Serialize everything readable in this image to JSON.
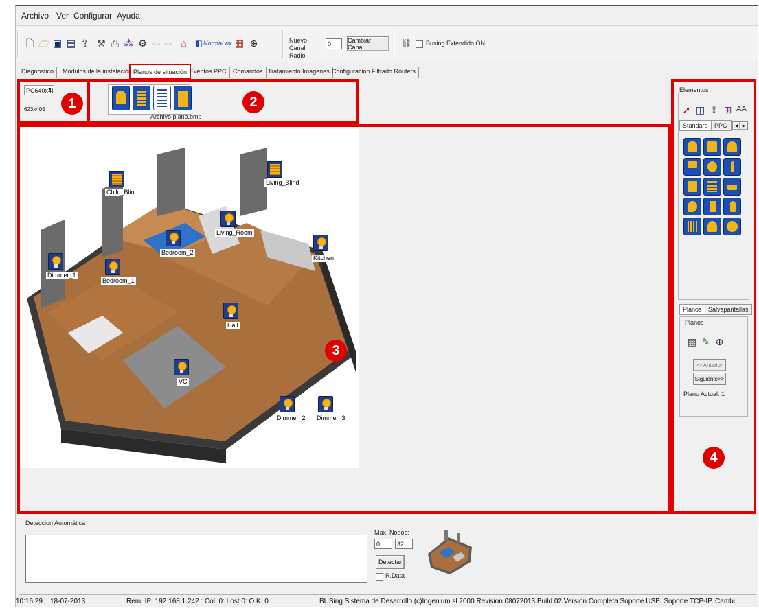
{
  "menu": [
    "Archivo",
    "Ver",
    "Configurar",
    "Ayuda"
  ],
  "toolbar": {
    "normalux_label": "NormaLux",
    "nuevo_canal_label": "Nuevo Canal Radio",
    "canal_value": "0",
    "cambiar_canal_label": "Cambiar Canal",
    "busing_extendido_label": "Busing Extendido ON"
  },
  "tabs": [
    {
      "label": "Diagnostico",
      "active": false
    },
    {
      "label": "Modulos de la instalación",
      "active": false
    },
    {
      "label": "Planos de situación",
      "active": true
    },
    {
      "label": "Eventos PPC",
      "active": false
    },
    {
      "label": "Comandos",
      "active": false
    },
    {
      "label": "Tratamiento Imagenes",
      "active": false
    },
    {
      "label": "Configuracion Filtrado Routers",
      "active": false
    }
  ],
  "resolution": {
    "selected": "PC640x4I",
    "size": "623x405"
  },
  "file": {
    "name": "Archivo plano.bmp"
  },
  "badges": [
    "1",
    "2",
    "3",
    "4"
  ],
  "plan": {
    "devices": [
      {
        "label": "Child_Blind",
        "type": "blind"
      },
      {
        "label": "Living_Blind",
        "type": "blind"
      },
      {
        "label": "Living_Room",
        "type": "bulb"
      },
      {
        "label": "Bedroom_2",
        "type": "bulb"
      },
      {
        "label": "Kitchen",
        "type": "bulb"
      },
      {
        "label": "Dimmer_1",
        "type": "bulb"
      },
      {
        "label": "Bedroom_1",
        "type": "bulb"
      },
      {
        "label": "Hall",
        "type": "bulb"
      },
      {
        "label": "VC",
        "type": "bulb"
      },
      {
        "label": "Dimmer_2",
        "type": "bulb"
      },
      {
        "label": "Dimmer_3",
        "type": "bulb"
      }
    ]
  },
  "elements_panel": {
    "title": "Elementos",
    "tabs": [
      "Standard",
      "PPC"
    ],
    "bottom_tabs": [
      "Planos",
      "Salvapantallas"
    ],
    "planos_group": "Planos",
    "anterior": "<<Anterior",
    "siguiente": "Siguiente>>",
    "plano_actual": "Plano Actual: 1"
  },
  "deteccion": {
    "title": "Deteccion Automática",
    "max_nodos_label": "Max. Nodos:",
    "min_value": "0",
    "max_value": "32",
    "detectar": "Detectar",
    "rdata": "R.Data"
  },
  "status": {
    "time": "10:16:29",
    "date": "18-07-2013",
    "rem_ip": "Rem. IP: 192.168.1.242 : Col. 0: Lost 0: O.K. 0",
    "info": "BUSing Sistema de Desarrollo (c)Ingenium sl 2000 Revision 08072013 Build 02 Version Completa Soporte USB. Soporte TCP-IP. Cambi"
  },
  "colors": {
    "highlight": "#e00000",
    "icon_blue": "#1f3d8c",
    "icon_yellow": "#f2b416"
  }
}
